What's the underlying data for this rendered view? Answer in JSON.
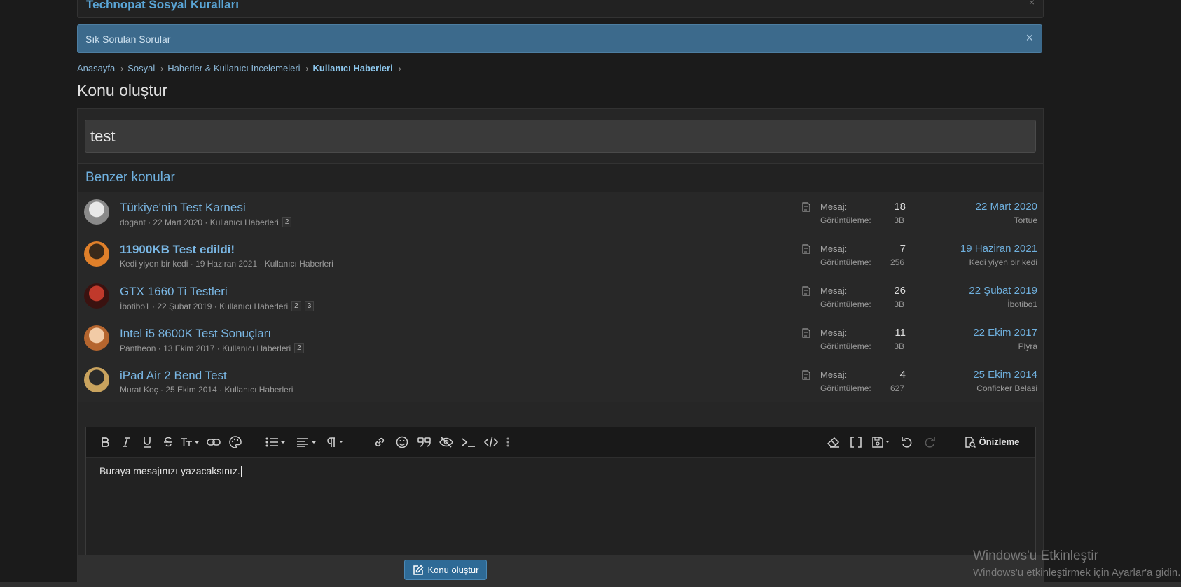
{
  "notices": {
    "top_title": "Technopat Sosyal Kuralları",
    "faq_label": "Sık Sorulan Sorular",
    "close_glyph": "×"
  },
  "breadcrumb": [
    "Anasayfa",
    "Sosyal",
    "Haberler & Kullanıcı İncelemeleri",
    "Kullanıcı Haberleri"
  ],
  "page_title": "Konu oluştur",
  "title_input": {
    "value": "test"
  },
  "similar": {
    "heading": "Benzer konular",
    "mesaj_label": "Mesaj:",
    "views_label": "Görüntüleme:",
    "rows": [
      {
        "title": "Türkiye'nin Test Karnesi",
        "author": "dogant",
        "date": "22 Mart 2020",
        "forum": "Kullanıcı Haberleri",
        "pages": [
          "2"
        ],
        "messages": "18",
        "views": "3B",
        "last_date": "22 Mart 2020",
        "last_user": "Tortue",
        "bold": false,
        "avatar_colors": [
          "#8a8a8a",
          "#e8e8e8"
        ]
      },
      {
        "title": "11900KB Test edildi!",
        "author": "Kedi yiyen bir kedi",
        "date": "19 Haziran 2021",
        "forum": "Kullanıcı Haberleri",
        "pages": [],
        "messages": "7",
        "views": "256",
        "last_date": "19 Haziran 2021",
        "last_user": "Kedi yiyen bir kedi",
        "bold": true,
        "avatar_colors": [
          "#e0802a",
          "#3a2a1a"
        ]
      },
      {
        "title": "GTX 1660 Ti Testleri",
        "author": "İbotibo1",
        "date": "22 Şubat 2019",
        "forum": "Kullanıcı Haberleri",
        "pages": [
          "2",
          "3"
        ],
        "messages": "26",
        "views": "3B",
        "last_date": "22 Şubat 2019",
        "last_user": "İbotibo1",
        "bold": false,
        "avatar_colors": [
          "#3a1210",
          "#c0392b"
        ]
      },
      {
        "title": "Intel i5 8600K Test Sonuçları",
        "author": "Pantheon",
        "date": "13 Ekim 2017",
        "forum": "Kullanıcı Haberleri",
        "pages": [
          "2"
        ],
        "messages": "11",
        "views": "3B",
        "last_date": "22 Ekim 2017",
        "last_user": "Plyra",
        "bold": false,
        "avatar_colors": [
          "#b5652e",
          "#f2cba6"
        ]
      },
      {
        "title": "iPad Air 2 Bend Test",
        "author": "Murat Koç",
        "date": "25 Ekim 2014",
        "forum": "Kullanıcı Haberleri",
        "pages": [],
        "messages": "4",
        "views": "627",
        "last_date": "25 Ekim 2014",
        "last_user": "Conficker Belasi",
        "bold": false,
        "avatar_colors": [
          "#c9a35e",
          "#2a2a2a"
        ]
      }
    ]
  },
  "editor": {
    "content": "Buraya mesajınızı yazacaksınız.",
    "preview_label": "Önizleme",
    "tools": [
      "bold-icon",
      "italic-icon",
      "underline-icon",
      "strikethrough-icon",
      "font-size-icon",
      "link-style-icon",
      "palette-icon",
      "list-icon",
      "align-icon",
      "paragraph-icon",
      "link-icon",
      "smiley-icon",
      "quote-icon",
      "hide-icon",
      "terminal-icon",
      "code-icon",
      "more-icon",
      "eraser-icon",
      "brackets-icon",
      "save-icon",
      "undo-icon",
      "redo-icon"
    ]
  },
  "submit_label": "Konu oluştur",
  "watermark": {
    "line1": "Windows'u Etkinleştir",
    "line2": "Windows'u etkinleştirmek için Ayarlar'a gidin."
  },
  "colors": {
    "accent": "#6fb0de",
    "faq_bg": "#3c6a8c",
    "submit_bg": "#2e6a96"
  }
}
